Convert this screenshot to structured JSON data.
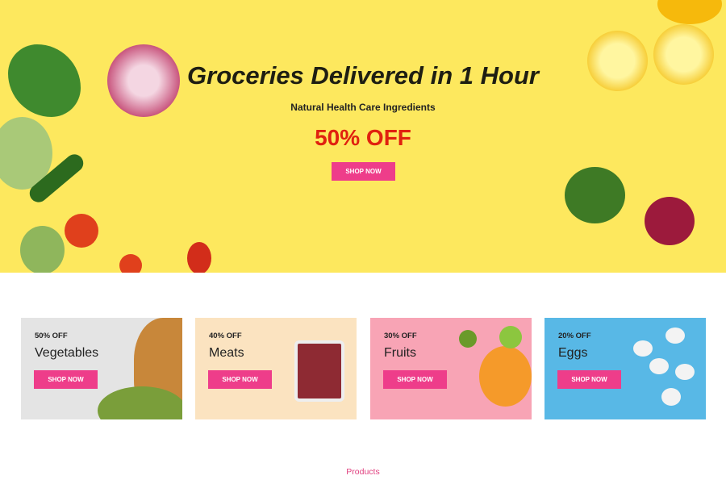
{
  "hero": {
    "title": "Groceries Delivered in 1 Hour",
    "subtitle": "Natural Health Care Ingredients",
    "discount": "50% OFF",
    "button": "SHOP NOW"
  },
  "categories": [
    {
      "discount": "50% OFF",
      "name": "Vegetables",
      "button": "SHOP NOW",
      "bg": "#e4e4e4"
    },
    {
      "discount": "40% OFF",
      "name": "Meats",
      "button": "SHOP NOW",
      "bg": "#fbe3c0"
    },
    {
      "discount": "30% OFF",
      "name": "Fruits",
      "button": "SHOP NOW",
      "bg": "#f8a4b5"
    },
    {
      "discount": "20% OFF",
      "name": "Eggs",
      "button": "SHOP NOW",
      "bg": "#58b8e6"
    }
  ],
  "section": {
    "title": "Products"
  },
  "colors": {
    "accent": "#ee3d8a",
    "hero_bg": "#fde85e",
    "discount": "#e0210f"
  }
}
